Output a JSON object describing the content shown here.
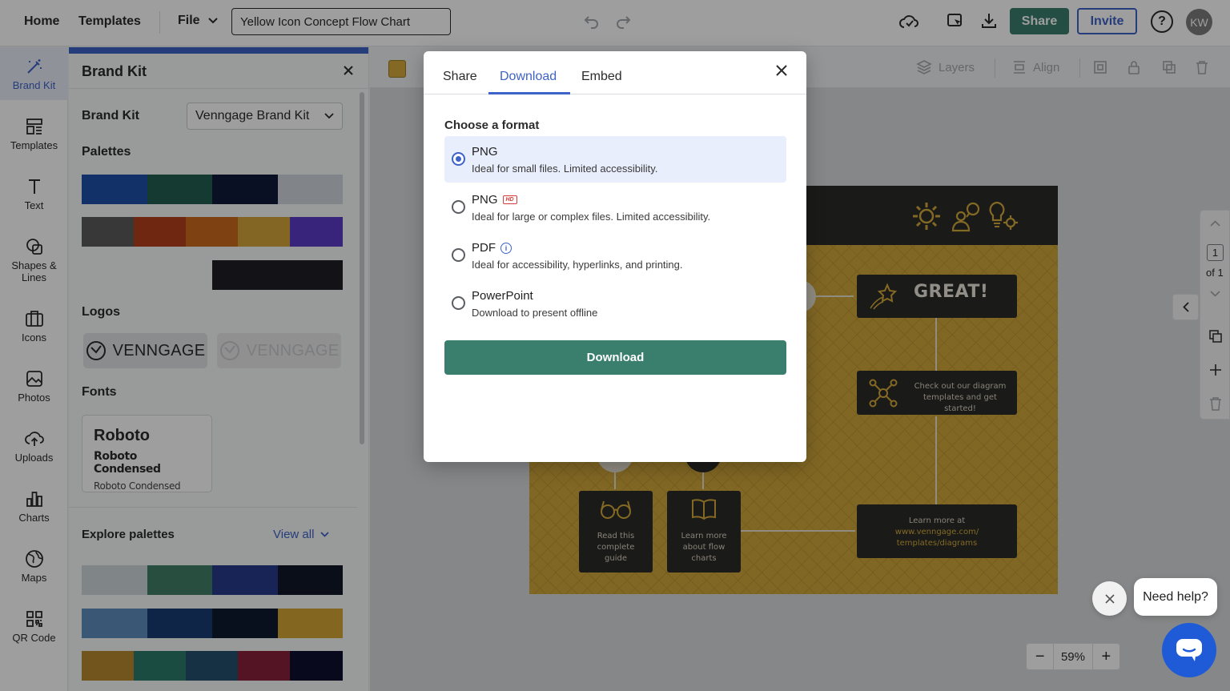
{
  "topbar": {
    "home": "Home",
    "templates": "Templates",
    "file": "File",
    "doc_title": "Yellow Icon Concept Flow Chart",
    "share": "Share",
    "invite": "Invite",
    "help": "?",
    "avatar": "KW"
  },
  "rail": {
    "items": [
      {
        "label": "Brand Kit",
        "icon": "magic-wand-icon"
      },
      {
        "label": "Templates",
        "icon": "templates-icon"
      },
      {
        "label": "Text",
        "icon": "text-icon"
      },
      {
        "label": "Shapes &\nLines",
        "icon": "shapes-icon"
      },
      {
        "label": "Icons",
        "icon": "icons-icon"
      },
      {
        "label": "Photos",
        "icon": "photos-icon"
      },
      {
        "label": "Uploads",
        "icon": "upload-cloud-icon"
      },
      {
        "label": "Charts",
        "icon": "charts-icon"
      },
      {
        "label": "Maps",
        "icon": "globe-icon"
      },
      {
        "label": "QR Code",
        "icon": "qr-code-icon"
      }
    ]
  },
  "brand_panel": {
    "title": "Brand Kit",
    "brand_kit_label": "Brand Kit",
    "brand_kit_value": "Venngage Brand Kit",
    "palettes_label": "Palettes",
    "palettes": [
      [
        "#1e4fa8",
        "#215e4f",
        "#101b3b",
        "#d0d7de"
      ],
      [
        "#5b5b5b",
        "#b3401e",
        "#cc6a1d",
        "#d4a53a",
        "#5b3bc7"
      ],
      [
        "#1f1f26"
      ]
    ],
    "logos_label": "Logos",
    "logo_text": "VENNGAGE",
    "logo_text_light": "VENNGAGE",
    "fonts_label": "Fonts",
    "font_card": {
      "primary": "Roboto",
      "secondary": "Roboto Condensed",
      "tertiary": "Roboto Condensed"
    },
    "explore_label": "Explore palettes",
    "view_all": "View all",
    "explore_palettes": [
      [
        "#cfd7dc",
        "#3f7f66",
        "#273a8c",
        "#0f1729"
      ],
      [
        "#5e8fbf",
        "#173c73",
        "#0c1a2e",
        "#d3a535"
      ],
      [
        "#b88a2f",
        "#2c7b6b",
        "#244e6e",
        "#8a2139",
        "#0e1030"
      ]
    ]
  },
  "toolbar2": {
    "layers": "Layers",
    "align": "Align",
    "accent_color": "#d4aa3a"
  },
  "design": {
    "great": "GREAT!",
    "box_diagram": "Check out our diagram\ntemplates and get started!",
    "box_read": "Read this\ncomplete\nguide",
    "box_learn_flow": "Learn more\nabout flow\ncharts",
    "box_learn_at": "Learn more at",
    "box_link": "www.venngage.com/\ntemplates/diagrams"
  },
  "pager": {
    "page": "1",
    "of": "of 1"
  },
  "zoom": {
    "minus": "−",
    "value": "59%",
    "plus": "+"
  },
  "help": {
    "bubble": "Need help?"
  },
  "modal": {
    "tabs": [
      "Share",
      "Download",
      "Embed"
    ],
    "active_tab": "Download",
    "choose_label": "Choose a format",
    "options": [
      {
        "title": "PNG",
        "desc": "Ideal for small files. Limited accessibility.",
        "selected": true
      },
      {
        "title": "PNG",
        "badge": "HD",
        "desc": "Ideal for large or complex files. Limited accessibility.",
        "selected": false
      },
      {
        "title": "PDF",
        "desc": "Ideal for accessibility, hyperlinks, and printing.",
        "selected": false
      },
      {
        "title": "PowerPoint",
        "desc": "Download to present offline",
        "selected": false
      }
    ],
    "download_button": "Download"
  }
}
